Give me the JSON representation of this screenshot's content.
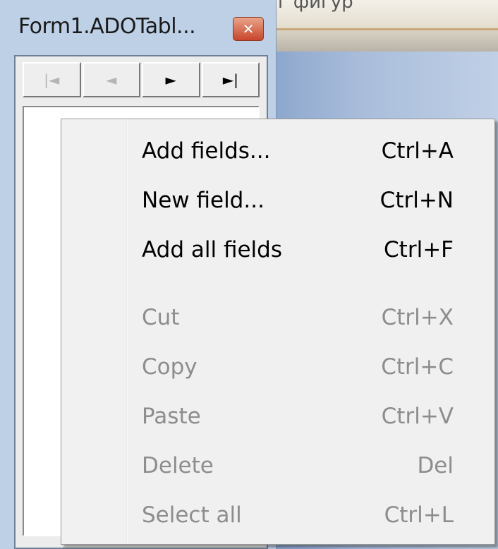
{
  "background_window": {
    "title_fragment": "г фигур"
  },
  "window": {
    "title": "Form1.ADOTabl...",
    "close_glyph": "✕"
  },
  "navigator": {
    "buttons": [
      {
        "name": "first",
        "glyph": "|◄",
        "enabled": false
      },
      {
        "name": "prior",
        "glyph": "◄",
        "enabled": false
      },
      {
        "name": "next",
        "glyph": "►",
        "enabled": true
      },
      {
        "name": "last",
        "glyph": "►|",
        "enabled": true
      }
    ]
  },
  "context_menu": {
    "items": [
      {
        "label": "Add fields...",
        "shortcut": "Ctrl+A",
        "enabled": true
      },
      {
        "label": "New field...",
        "shortcut": "Ctrl+N",
        "enabled": true
      },
      {
        "label": "Add all fields",
        "shortcut": "Ctrl+F",
        "enabled": true
      },
      {
        "label": "Cut",
        "shortcut": "Ctrl+X",
        "enabled": false
      },
      {
        "label": "Copy",
        "shortcut": "Ctrl+C",
        "enabled": false
      },
      {
        "label": "Paste",
        "shortcut": "Ctrl+V",
        "enabled": false
      },
      {
        "label": "Delete",
        "shortcut": "Del",
        "enabled": false
      },
      {
        "label": "Select all",
        "shortcut": "Ctrl+L",
        "enabled": false
      }
    ]
  },
  "colors": {
    "enabled_text": "#000000",
    "disabled_text": "#8d8d8d",
    "menu_background": "#f0f0f0",
    "close_button": "#c9452b"
  }
}
